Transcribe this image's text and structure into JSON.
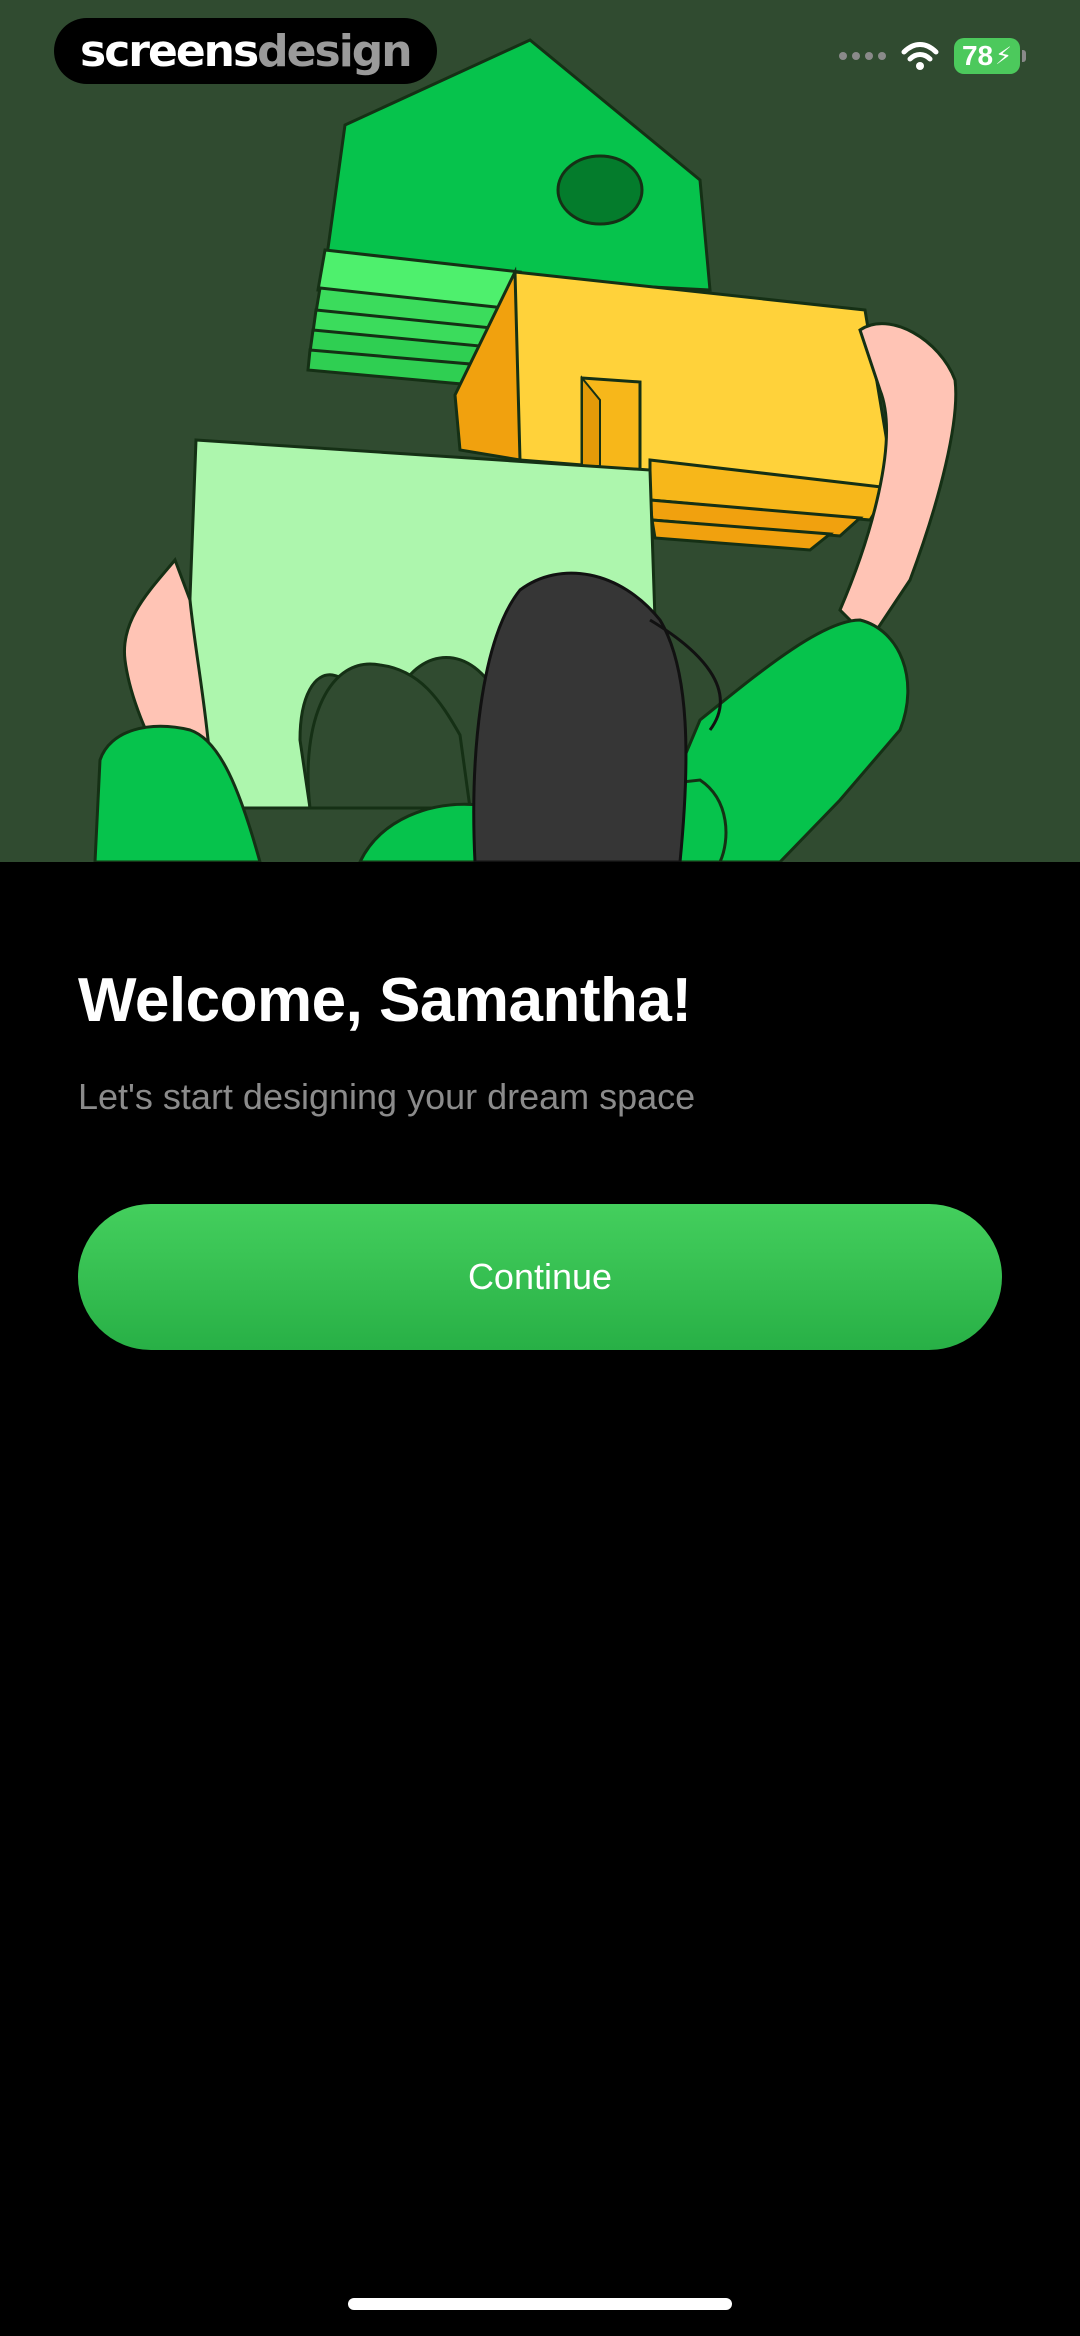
{
  "brand": {
    "part1": "screens",
    "part2": "design"
  },
  "status_bar": {
    "battery": "78",
    "wifi_icon": "wifi-icon",
    "signal_icon": "signal-dots-icon",
    "charging_icon": "bolt-icon"
  },
  "hero": {
    "illustration": "woman-holding-house-pieces-illustration"
  },
  "welcome": {
    "title": "Welcome, Samantha!",
    "subtitle": "Let's start designing your dream space",
    "continue_label": "Continue"
  },
  "colors": {
    "hero_bg": "#304b30",
    "accent_green": "#34c153",
    "subtitle_gray": "#8b8b8b"
  }
}
